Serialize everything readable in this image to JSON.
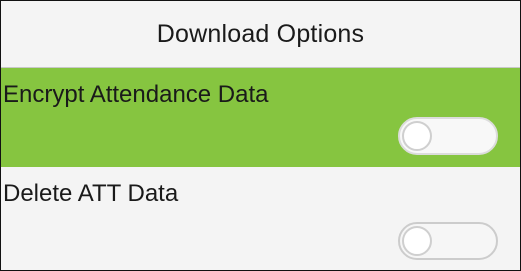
{
  "header": {
    "title": "Download Options"
  },
  "options": [
    {
      "label": "Encrypt Attendance Data",
      "enabled": false,
      "selected": true
    },
    {
      "label": "Delete ATT Data",
      "enabled": false,
      "selected": false
    }
  ],
  "colors": {
    "highlight": "#86c540",
    "background": "#f4f4f4",
    "toggle_off": "#f6f6f6"
  }
}
